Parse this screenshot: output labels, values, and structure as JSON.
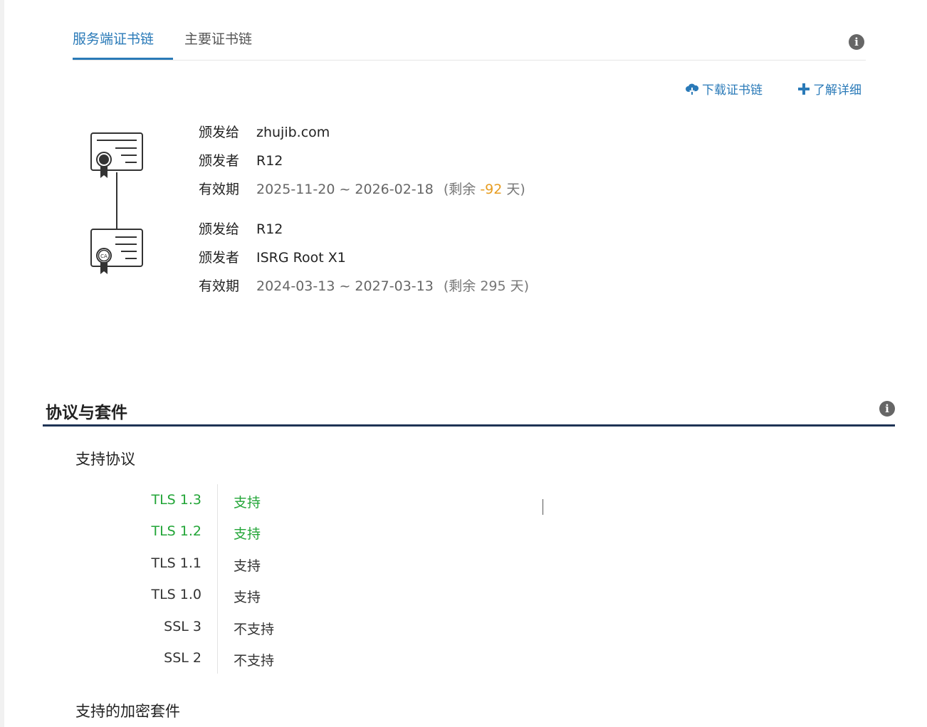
{
  "tabs": {
    "active": "服务端证书链",
    "second": "主要证书链",
    "info_icon": "info-icon"
  },
  "actions": {
    "download": "下载证书链",
    "learn_more": "了解详细",
    "download_icon": "cloud-download-icon",
    "learn_icon": "plus-icon"
  },
  "certificates": [
    {
      "icon": "certificate-icon",
      "issued_to_label": "颁发给",
      "issued_to": "zhujib.com",
      "issuer_label": "颁发者",
      "issuer": "R12",
      "validity_label": "有效期",
      "validity": "2025-11-20 ~ 2026-02-18",
      "remaining_prefix": "(剩余",
      "remaining_days": "-92",
      "remaining_suffix": "天)"
    },
    {
      "icon": "ca-certificate-icon",
      "issued_to_label": "颁发给",
      "issued_to": "R12",
      "issuer_label": "颁发者",
      "issuer": "ISRG Root X1",
      "validity_label": "有效期",
      "validity": "2024-03-13 ~ 2027-03-13",
      "remaining_prefix": "(剩余",
      "remaining_days": "295",
      "remaining_suffix": "天)"
    }
  ],
  "section": {
    "title": "协议与套件",
    "protocols_title": "支持协议",
    "ciphers_title": "支持的加密套件"
  },
  "protocols": [
    {
      "name": "TLS 1.3",
      "status": "支持",
      "color": "#22a537"
    },
    {
      "name": "TLS 1.2",
      "status": "支持",
      "color": "#22a537"
    },
    {
      "name": "TLS 1.1",
      "status": "支持",
      "color": "#333333"
    },
    {
      "name": "TLS 1.0",
      "status": "支持",
      "color": "#333333"
    },
    {
      "name": "SSL 3",
      "status": "不支持",
      "color": "#333333"
    },
    {
      "name": "SSL 2",
      "status": "不支持",
      "color": "#333333"
    }
  ],
  "colors": {
    "accent": "#2a7ab8",
    "section_rule": "#1e3355",
    "warning": "#e79d21",
    "supported": "#22a537"
  }
}
